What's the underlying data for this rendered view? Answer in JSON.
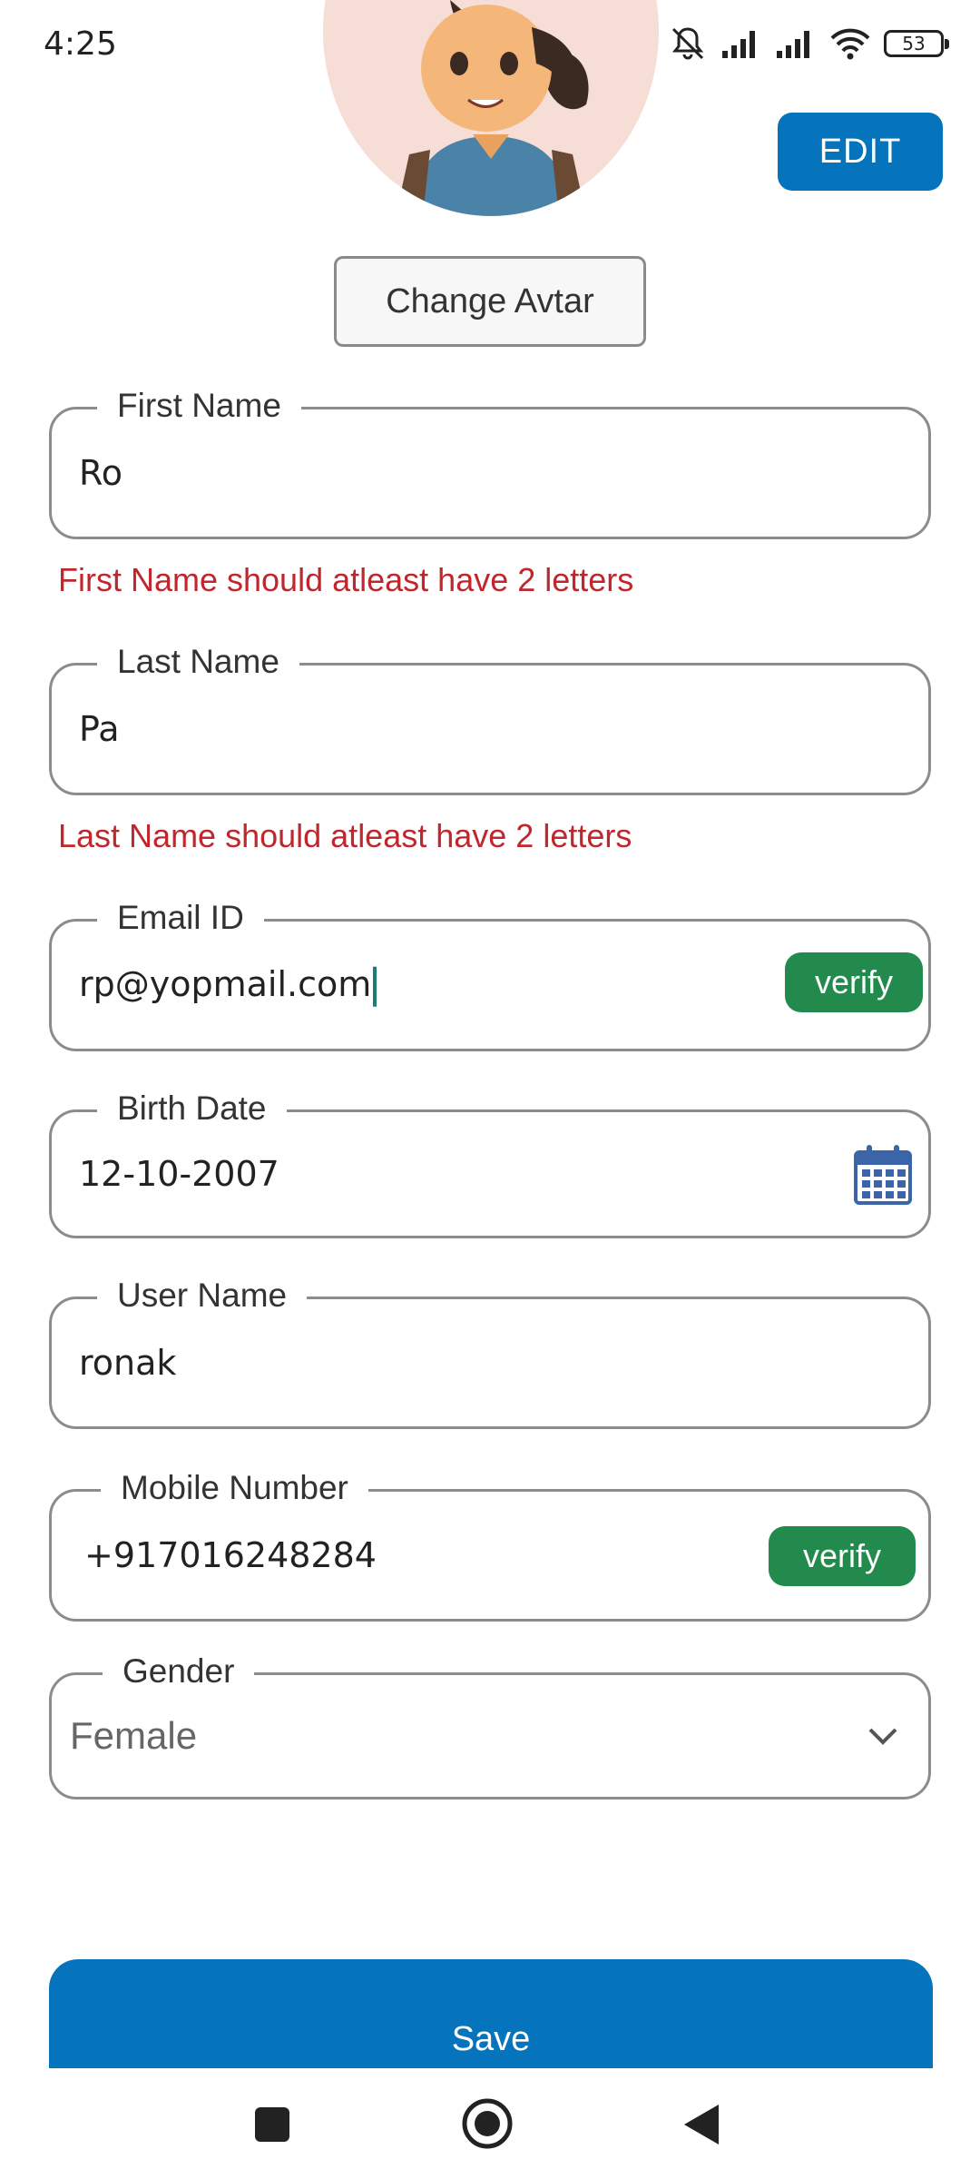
{
  "status_bar": {
    "time": "4:25",
    "battery": "53"
  },
  "header": {
    "edit_label": "EDIT",
    "change_avatar_label": "Change Avtar"
  },
  "form": {
    "first_name": {
      "label": "First Name",
      "value": "Ro",
      "error": "First Name should atleast have 2 letters"
    },
    "last_name": {
      "label": "Last Name",
      "value": "Pa",
      "error": "Last Name should atleast have 2 letters"
    },
    "email": {
      "label": "Email ID",
      "value": "rp@yopmail.com",
      "verify_label": "verify"
    },
    "birth_date": {
      "label": "Birth Date",
      "value": "12-10-2007"
    },
    "user_name": {
      "label": "User Name",
      "value": "ronak"
    },
    "mobile": {
      "label": "Mobile Number",
      "value": "+917016248284",
      "verify_label": "verify"
    },
    "gender": {
      "label": "Gender",
      "value": "Female"
    }
  },
  "save_label": "Save",
  "colors": {
    "primary": "#0673bd",
    "verify": "#218a4c",
    "error": "#c0272d"
  },
  "icons": [
    "mute-icon",
    "signal-icon",
    "wifi-icon",
    "battery-icon",
    "calendar-icon",
    "chevron-down-icon",
    "nav-recents-icon",
    "nav-home-icon",
    "nav-back-icon"
  ]
}
